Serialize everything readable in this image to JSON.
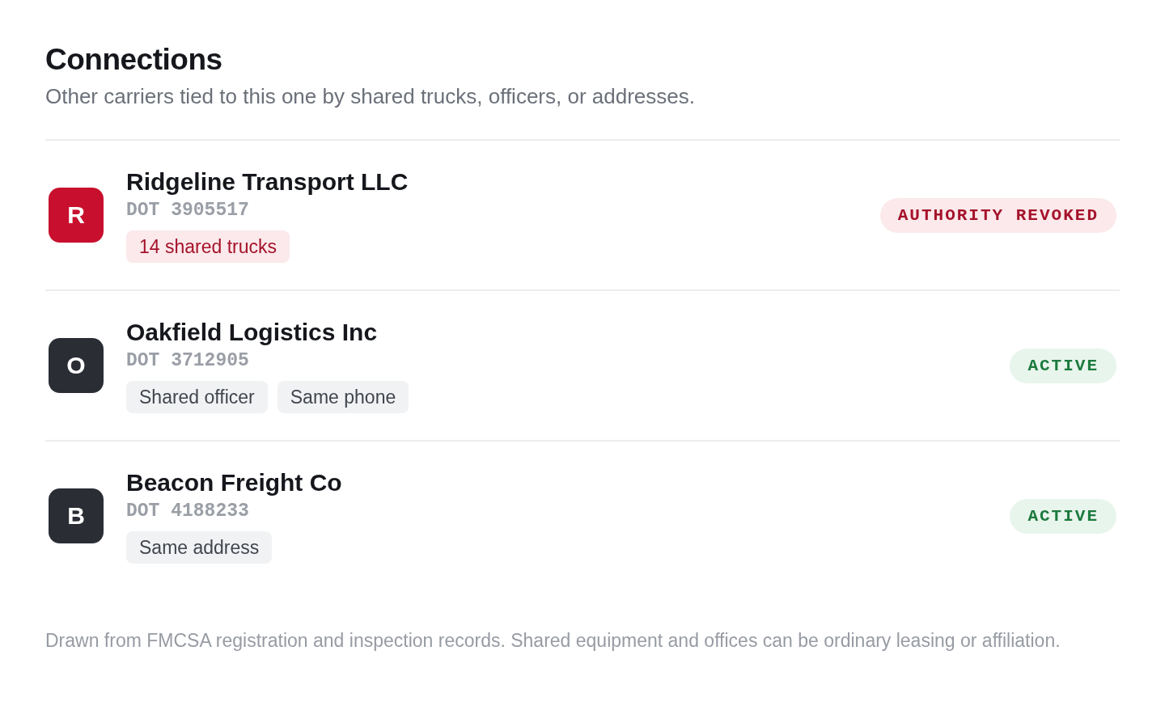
{
  "header": {
    "title": "Connections",
    "subtitle": "Other carriers tied to this one by shared trucks, officers, or addresses."
  },
  "connections": [
    {
      "initial": "R",
      "color": "#c8102e",
      "name": "Ridgeline Transport LLC",
      "dot": "DOT 3905517",
      "tags": [
        {
          "label": "14 shared trucks",
          "kind": "alert"
        }
      ],
      "status": {
        "label": "AUTHORITY REVOKED",
        "kind": "revoked"
      }
    },
    {
      "initial": "O",
      "color": "#2a2d34",
      "name": "Oakfield Logistics Inc",
      "dot": "DOT 3712905",
      "tags": [
        {
          "label": "Shared officer",
          "kind": "neutral"
        },
        {
          "label": "Same phone",
          "kind": "neutral"
        }
      ],
      "status": {
        "label": "ACTIVE",
        "kind": "active"
      }
    },
    {
      "initial": "B",
      "color": "#2a2d34",
      "name": "Beacon Freight Co",
      "dot": "DOT 4188233",
      "tags": [
        {
          "label": "Same address",
          "kind": "neutral"
        }
      ],
      "status": {
        "label": "ACTIVE",
        "kind": "active"
      }
    }
  ],
  "footnote": "Drawn from FMCSA registration and inspection records. Shared equipment and offices can be ordinary leasing or affiliation."
}
